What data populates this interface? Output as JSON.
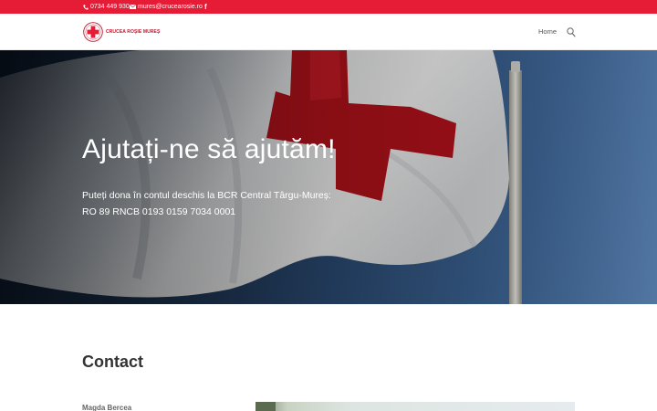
{
  "topbar": {
    "phone": "0734 449 930",
    "email": "mures@crucearosie.ro",
    "social_icon": "facebook-icon",
    "background": "#e61b36"
  },
  "header": {
    "logo_text": "CRUCEA ROȘIE MUREȘ",
    "nav": [
      {
        "label": "Home"
      }
    ],
    "search_icon": "search-icon"
  },
  "hero": {
    "title": "Ajutați-ne să ajutăm!",
    "line1": "Puteți dona în contul deschis la BCR Central Târgu-Mureș:",
    "line2": "RO 89 RNCB 0193 0159 7034 0001"
  },
  "contact": {
    "title": "Contact",
    "name": "Magda Bercea"
  },
  "colors": {
    "accent_red": "#e61b36",
    "cross_red": "#b5121b"
  }
}
